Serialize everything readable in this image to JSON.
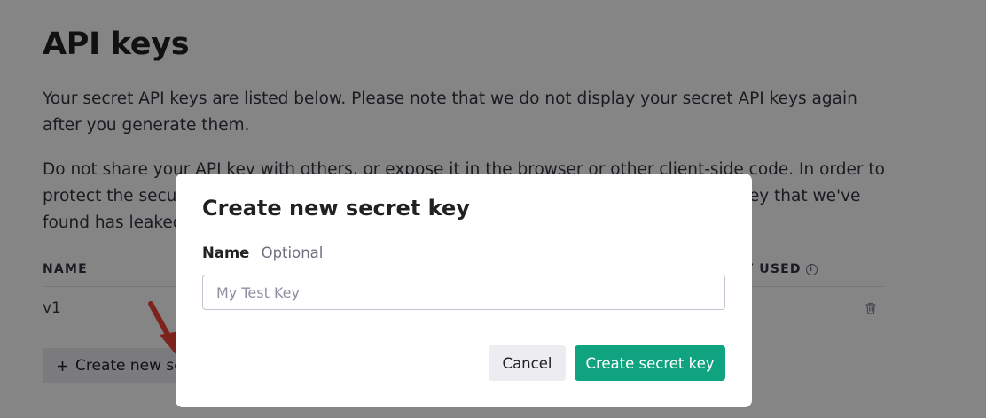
{
  "page": {
    "title": "API keys",
    "intro": "Your secret API keys are listed below. Please note that we do not display your secret API keys again after you generate them.",
    "warning": "Do not share your API key with others, or expose it in the browser or other client-side code. In order to protect the security of your account, OpenAI may also automatically disable any API key that we've found has leaked publicly."
  },
  "table": {
    "columns": {
      "name": "NAME",
      "last_used": "LAST USED"
    },
    "rows": [
      {
        "name": "v1"
      }
    ]
  },
  "actions": {
    "create_label": "Create new secret key",
    "create_icon": "plus-icon"
  },
  "modal": {
    "title": "Create new secret key",
    "name_label": "Name",
    "name_optional": "Optional",
    "name_placeholder": "My Test Key",
    "name_value": "",
    "cancel_label": "Cancel",
    "submit_label": "Create secret key"
  },
  "colors": {
    "primary": "#10a37f",
    "secondary_button": "#ececf1",
    "annotation_arrow": "#ef4136"
  }
}
